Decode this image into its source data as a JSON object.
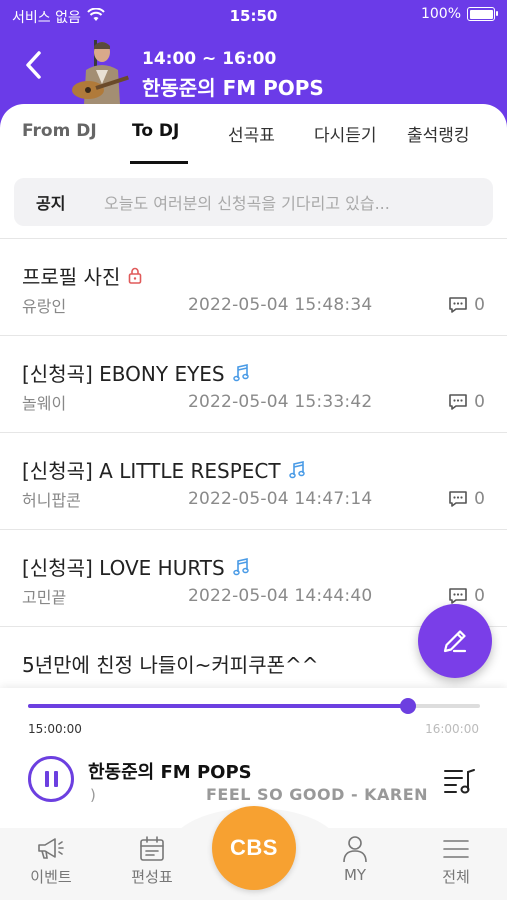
{
  "status_bar": {
    "carrier": "서비스 없음",
    "time": "15:50",
    "battery": "100%"
  },
  "header": {
    "time_range": "14:00 ~ 16:00",
    "program_title": "한동준의 FM POPS"
  },
  "tabs": [
    {
      "label": "From DJ"
    },
    {
      "label": "To DJ",
      "active": true
    },
    {
      "label": "선곡표"
    },
    {
      "label": "다시듣기"
    },
    {
      "label": "출석랭킹"
    }
  ],
  "notice": {
    "label": "공지",
    "text": "오늘도 여러분의 신청곡을 기다리고 있습..."
  },
  "posts": [
    {
      "title": "프로필  사진",
      "icon": "lock-icon",
      "author": "유랑인",
      "date": "2022-05-04 15:48:34",
      "comments": "0"
    },
    {
      "title": "[신청곡] EBONY EYES",
      "icon": "music-note-icon",
      "author": "놀웨이",
      "date": "2022-05-04 15:33:42",
      "comments": "0"
    },
    {
      "title": "[신청곡] A LITTLE RESPECT",
      "icon": "music-note-icon",
      "author": "허니팝콘",
      "date": "2022-05-04 14:47:14",
      "comments": "0"
    },
    {
      "title": "[신청곡] LOVE HURTS",
      "icon": "music-note-icon",
      "author": "고민끝",
      "date": "2022-05-04 14:44:40",
      "comments": "0"
    },
    {
      "title": "5년만에 친정 나들이~커피쿠폰^^",
      "icon": "",
      "author": "",
      "date": "",
      "comments": ""
    }
  ],
  "player": {
    "start_time": "15:00:00",
    "end_time": "16:00:00",
    "progress": 0.84,
    "title": "한동준의 FM POPS",
    "paren": ")",
    "song": "FEEL SO GOOD - KAREN"
  },
  "bottom_nav": [
    {
      "label": "이벤트",
      "icon": "megaphone-icon"
    },
    {
      "label": "편성표",
      "icon": "calendar-icon"
    },
    {
      "label": "CBS",
      "icon": "cbs-logo"
    },
    {
      "label": "MY",
      "icon": "user-icon"
    },
    {
      "label": "전체",
      "icon": "menu-icon"
    }
  ],
  "colors": {
    "brand": "#6b3be8",
    "accent_orange": "#f7a131",
    "note_blue": "#4a9be6",
    "lock_red": "#e05a5a"
  }
}
